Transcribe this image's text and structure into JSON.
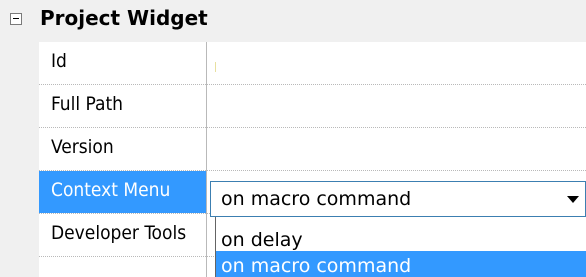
{
  "category": {
    "title": "Project Widget",
    "expanded": true
  },
  "properties": [
    {
      "label": "Id",
      "value": ""
    },
    {
      "label": "Full Path",
      "value": ""
    },
    {
      "label": "Version",
      "value": ""
    },
    {
      "label": "Context Menu",
      "value": "on macro command",
      "selected": true
    },
    {
      "label": "Developer Tools",
      "value": ""
    }
  ],
  "context_menu_combo": {
    "selected_value": "on macro command",
    "options": [
      "on delay",
      "on macro command"
    ],
    "highlighted_option": "on macro command"
  },
  "colors": {
    "selection": "#3399ff",
    "gutter": "#f0f0f0"
  }
}
